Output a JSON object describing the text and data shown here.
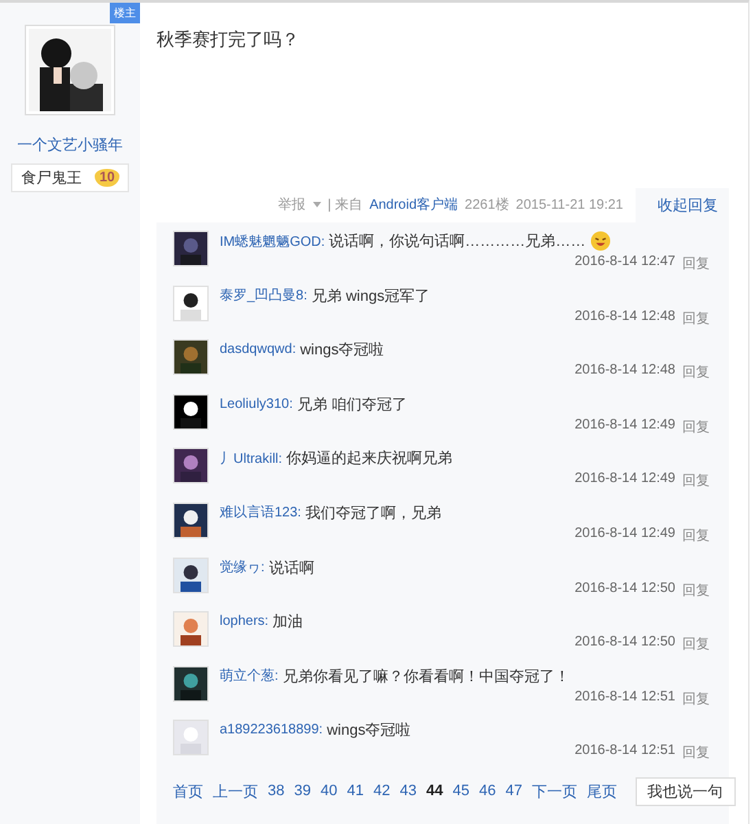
{
  "author": {
    "badge": "楼主",
    "name": "一个文艺小骚年",
    "title": "食尸鬼王",
    "level": "10"
  },
  "post": {
    "text": "秋季赛打完了吗？",
    "report": "举报",
    "source_prefix": "| 来自",
    "source": "Android客户端",
    "floor": "2261楼",
    "time": "2015-11-21 19:21",
    "collapse": "收起回复"
  },
  "replies": [
    {
      "user": "IM蟋魅魍魉GOD:",
      "text": "说话啊，你说句话啊…………兄弟……",
      "emoji": true,
      "time": "2016-8-14 12:47",
      "action": "回复"
    },
    {
      "user": "泰罗_凹凸曼8:",
      "text": "兄弟 wings冠军了",
      "emoji": false,
      "time": "2016-8-14 12:48",
      "action": "回复"
    },
    {
      "user": "dasdqwqwd:",
      "text": "wings夺冠啦",
      "emoji": false,
      "time": "2016-8-14 12:48",
      "action": "回复"
    },
    {
      "user": "Leoliuly310:",
      "text": "兄弟 咱们夺冠了",
      "emoji": false,
      "time": "2016-8-14 12:49",
      "action": "回复"
    },
    {
      "user": "丿Ultrakill:",
      "text": "你妈逼的起来庆祝啊兄弟",
      "emoji": false,
      "time": "2016-8-14 12:49",
      "action": "回复"
    },
    {
      "user": "难以言语123:",
      "text": "我们夺冠了啊，兄弟",
      "emoji": false,
      "time": "2016-8-14 12:49",
      "action": "回复"
    },
    {
      "user": "觉缘ヮ:",
      "text": "说话啊",
      "emoji": false,
      "time": "2016-8-14 12:50",
      "action": "回复"
    },
    {
      "user": "lophers:",
      "text": "加油",
      "emoji": false,
      "time": "2016-8-14 12:50",
      "action": "回复"
    },
    {
      "user": "萌立个葱:",
      "text": "兄弟你看见了嘛？你看看啊！中国夺冠了！",
      "emoji": false,
      "time": "2016-8-14 12:51",
      "action": "回复"
    },
    {
      "user": "a189223618899:",
      "text": "wings夺冠啦",
      "emoji": false,
      "time": "2016-8-14 12:51",
      "action": "回复"
    }
  ],
  "pagination": [
    {
      "label": "首页",
      "selected": false
    },
    {
      "label": "上一页",
      "selected": false
    },
    {
      "label": "38",
      "selected": false
    },
    {
      "label": "39",
      "selected": false
    },
    {
      "label": "40",
      "selected": false
    },
    {
      "label": "41",
      "selected": false
    },
    {
      "label": "42",
      "selected": false
    },
    {
      "label": "43",
      "selected": false
    },
    {
      "label": "44",
      "selected": true
    },
    {
      "label": "45",
      "selected": false
    },
    {
      "label": "46",
      "selected": false
    },
    {
      "label": "47",
      "selected": false
    },
    {
      "label": "下一页",
      "selected": false
    },
    {
      "label": "尾页",
      "selected": false
    }
  ],
  "reply_button": "我也说一句"
}
